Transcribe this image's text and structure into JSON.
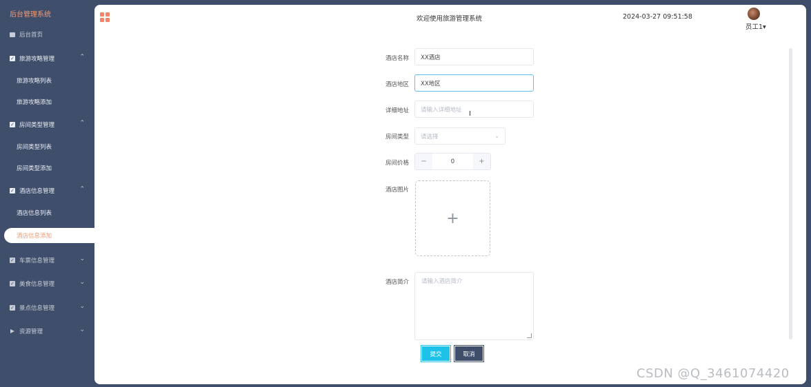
{
  "sidebar": {
    "brand": "后台管理系统",
    "home": "后台首页",
    "groups": [
      {
        "label": "旅游攻略管理",
        "children": [
          "旅游攻略列表",
          "旅游攻略添加"
        ]
      },
      {
        "label": "房间类型管理",
        "children": [
          "房间类型列表",
          "房间类型添加"
        ]
      },
      {
        "label": "酒店信息管理",
        "children": [
          "酒店信息列表",
          "酒店信息添加"
        ]
      },
      {
        "label": "车票信息管理"
      },
      {
        "label": "美食信息管理"
      },
      {
        "label": "景点信息管理"
      },
      {
        "label": "资源管理"
      }
    ]
  },
  "header": {
    "title": "欢迎使用旅游管理系统",
    "datetime": "2024-03-27 09:51:58",
    "user": "员工1"
  },
  "form": {
    "name_label": "酒店名称",
    "name_value": "XX酒店",
    "region_label": "酒店地区",
    "region_value": "XX地区",
    "address_label": "详细地址",
    "address_placeholder": "请输入详细地址",
    "room_type_label": "房间类型",
    "room_type_placeholder": "请选择",
    "price_label": "房间价格",
    "price_value": "0",
    "image_label": "酒店图片",
    "intro_label": "酒店简介",
    "intro_placeholder": "请输入酒店简介",
    "submit_label": "提交",
    "cancel_label": "取消"
  },
  "watermark": "CSDN @Q_3461074420",
  "colors": {
    "sidebar_bg": "#3f4e6a",
    "accent": "#f29a76",
    "submit": "#1ec1e8"
  }
}
